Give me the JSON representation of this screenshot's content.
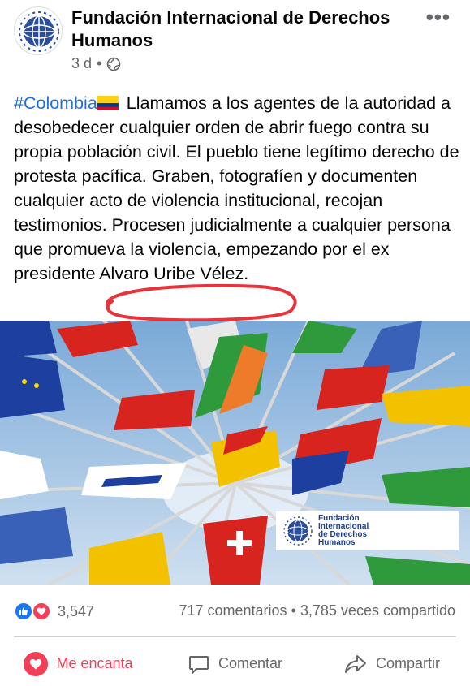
{
  "post": {
    "page_name": "Fundación Internacional de Derechos Humanos",
    "time_ago": "3 d",
    "separator": "•",
    "audience_icon": "globe-icon",
    "more_label": "•••",
    "hashtag": "#Colombia",
    "text_before_highlight": " Llamamos a los agentes de la autoridad a desobedecer cualquier orden de abrir fuego contra su propia población civil. El pueblo tiene legítimo derecho de protesta pacífica. Graben, fotografíen y documenten cualquier acto de violencia institucional, recojan testimonios. Procesen judicialmente a cualquier persona que promueva la violencia, empezando por el ex presidente ",
    "highlighted_text": "Alvaro Uribe Vélez.",
    "image_logo_text": "Fundación\nInternacional\nde Derechos\nHumanos"
  },
  "engagement": {
    "reaction_count": "3,547",
    "comments": "717 comentarios",
    "dot": "•",
    "shares": "3,785 veces compartido"
  },
  "actions": {
    "love": "Me encanta",
    "comment": "Comentar",
    "share": "Compartir"
  },
  "colors": {
    "link_blue": "#216fdb",
    "love_red": "#f33e58",
    "like_blue": "#1877f2",
    "annotation_red": "#e8333b"
  }
}
